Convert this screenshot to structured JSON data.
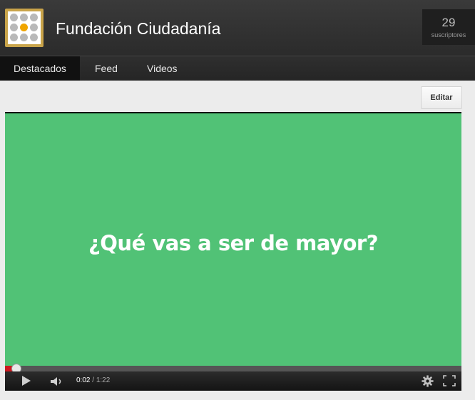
{
  "channel": {
    "title": "Fundación Ciudadanía",
    "subscribers_count": "29",
    "subscribers_label": "suscriptores",
    "logo_icon": "dot-grid-logo",
    "logo_colors": {
      "frame": "#c9a44a",
      "dots": "#b9b9b9",
      "center": "#f0a500"
    }
  },
  "tabs": [
    {
      "label": "Destacados",
      "active": true
    },
    {
      "label": "Feed",
      "active": false
    },
    {
      "label": "Videos",
      "active": false
    }
  ],
  "toolbar": {
    "edit_label": "Editar"
  },
  "video": {
    "frame_text": "¿Qué vas a ser de mayor?",
    "background_color": "#51c276",
    "current_time": "0:02",
    "separator": "/",
    "duration": "1:22",
    "progress_fraction": 0.025,
    "icons": [
      "play-icon",
      "volume-icon",
      "settings-gear-icon",
      "fullscreen-icon"
    ]
  }
}
